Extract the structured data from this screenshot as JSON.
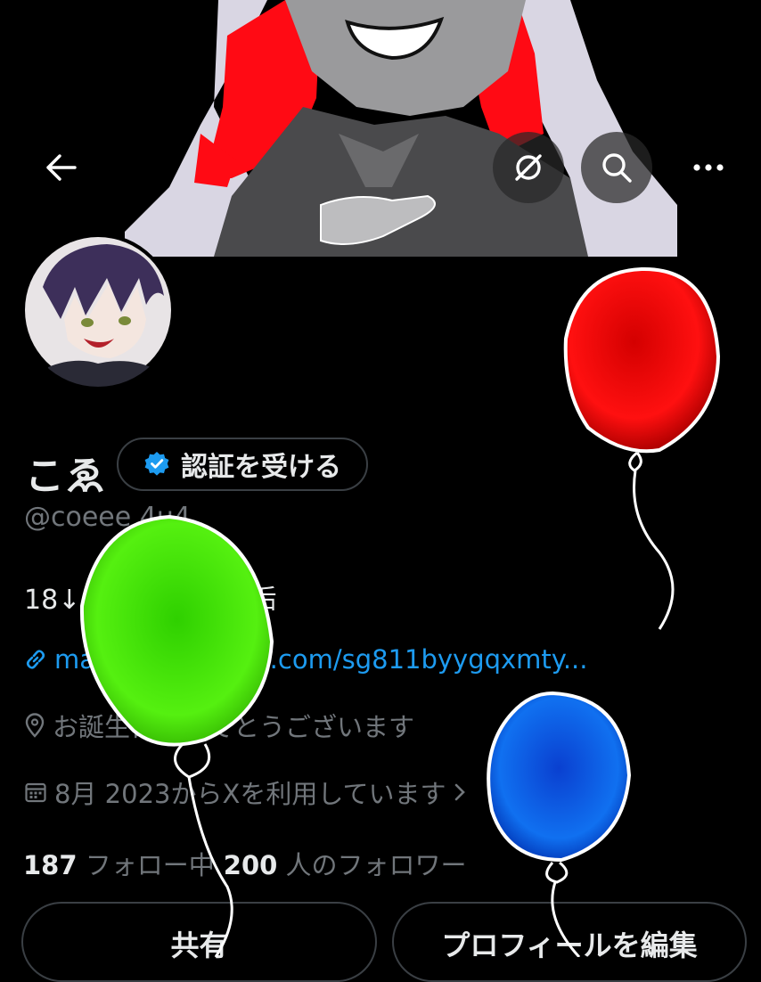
{
  "profile": {
    "name": "こゑ",
    "handle": "@coeee 4u4",
    "bio": "18↓/趣味・絵描き垢",
    "link": "marshmallow-qa.com/sg811byygqxmty...",
    "location": "お誕生日おめでとうございます",
    "joined": "8月 2023からXを利用しています",
    "following_count": "187",
    "following_label": "フォロー中",
    "followers_count": "200",
    "followers_label": "人のフォロワー"
  },
  "actions": {
    "verify_label": "認証を受ける",
    "share_label": "共有",
    "edit_label": "プロフィールを編集"
  },
  "icons": [
    "back-arrow-icon",
    "grok-icon",
    "search-icon",
    "more-icon",
    "verified-badge-icon",
    "link-icon",
    "location-icon",
    "calendar-icon",
    "chevron-right-icon"
  ],
  "colors": {
    "accent": "#1d9bf0",
    "muted": "#71767b",
    "text": "#e7e9ea",
    "background": "#000000"
  }
}
